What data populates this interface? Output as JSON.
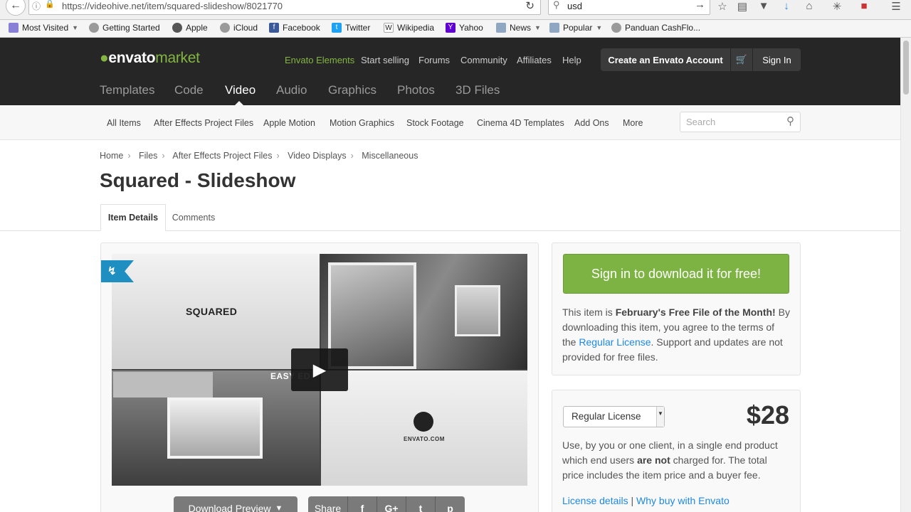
{
  "browser": {
    "url": "https://videohive.net/item/squared-slideshow/8021770",
    "search_value": "usd",
    "bookmarks": [
      "Most Visited",
      "Getting Started",
      "Apple",
      "iCloud",
      "Facebook",
      "Twitter",
      "Wikipedia",
      "Yahoo",
      "News",
      "Popular",
      "Panduan CashFlo..."
    ]
  },
  "header": {
    "logo_prefix": "envato",
    "logo_suffix": "market",
    "top_links": [
      "Envato Elements",
      "Start selling",
      "Forums",
      "Community",
      "Affiliates",
      "Help"
    ],
    "create_account": "Create an Envato Account",
    "sign_in": "Sign In",
    "categories": [
      "Templates",
      "Code",
      "Video",
      "Audio",
      "Graphics",
      "Photos",
      "3D Files"
    ],
    "active_category": "Video"
  },
  "subnav": {
    "items": [
      "All Items",
      "After Effects Project Files",
      "Apple Motion",
      "Motion Graphics",
      "Stock Footage",
      "Cinema 4D Templates",
      "Add Ons",
      "More"
    ],
    "search_placeholder": "Search"
  },
  "breadcrumb": [
    "Home",
    "Files",
    "After Effects Project Files",
    "Video Displays",
    "Miscellaneous"
  ],
  "page_title": "Squared - Slideshow",
  "tabs": [
    "Item Details",
    "Comments"
  ],
  "preview": {
    "thumb_text": "SQUARED",
    "overlay_text": "EASY ED",
    "logo_text": "ENVATO.COM",
    "download_preview": "Download Preview",
    "share_label": "Share",
    "share_icons": [
      "f",
      "G+",
      "t",
      "p"
    ]
  },
  "purchase": {
    "free_button": "Sign in to download it for free!",
    "free_line1": "This item is ",
    "free_bold": "February's Free File of the Month!",
    "free_line2": " By downloading this item, you agree to the terms of the ",
    "free_link": "Regular License",
    "free_line3": ". Support and updates are not provided for free files.",
    "license_option": "Regular License",
    "price": "$28",
    "use_part1": "Use, by you or one client, in a single end product which end users ",
    "use_bold": "are not",
    "use_part2": " charged for. The total price includes the item price and a buyer fee.",
    "link_license": "License details",
    "link_sep": "|",
    "link_why": "Why buy with Envato"
  },
  "colors": {
    "header_bg": "#262626",
    "brand_green": "#82b541",
    "cta_green": "#7cb342",
    "link_blue": "#1e88e5",
    "ribbon_blue": "#1f8fc2"
  }
}
